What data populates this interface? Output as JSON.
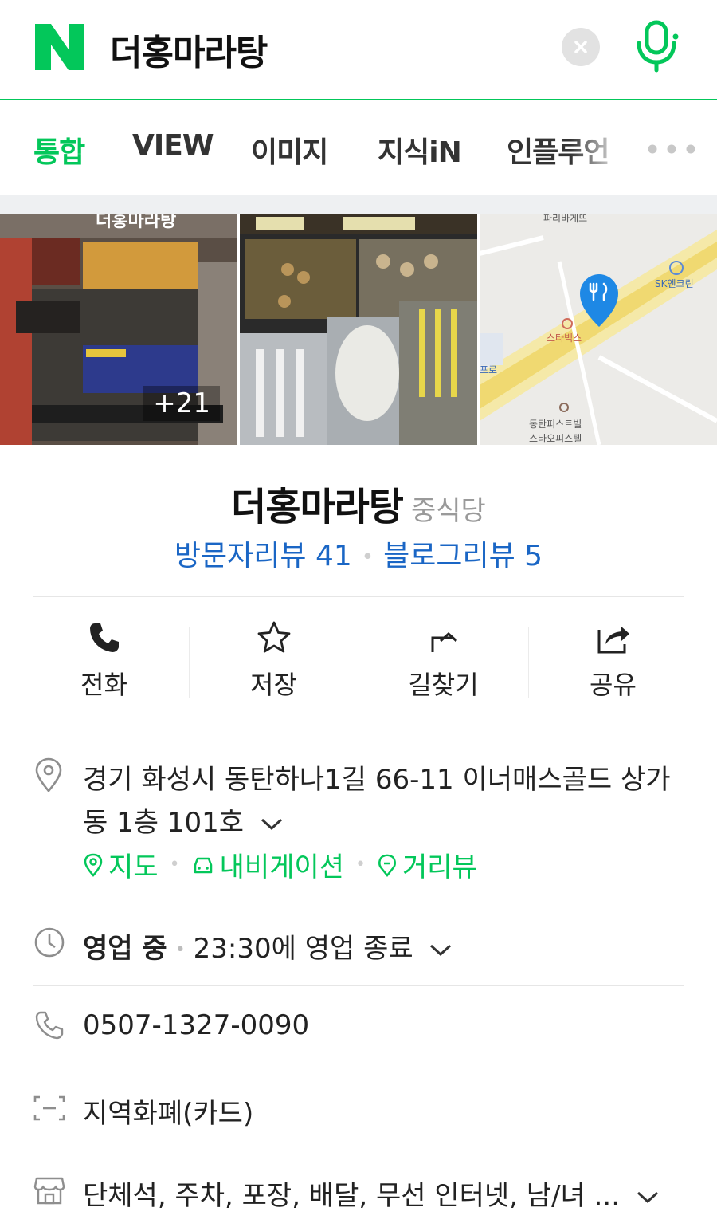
{
  "search": {
    "logo": "N",
    "query": "더홍마라탕",
    "brand_color": "#03c75a"
  },
  "tabs": [
    {
      "label": "통합",
      "active": true
    },
    {
      "label": "VIEW",
      "active": false
    },
    {
      "label": "이미지",
      "active": false
    },
    {
      "label": "지식iN",
      "active": false
    },
    {
      "label": "인플루언",
      "active": false
    }
  ],
  "photos": {
    "count_label": "+21",
    "storefront_text": "더홍마라탕",
    "map_labels": {
      "top": "파리바게뜨",
      "right": "SK엔크린",
      "cafe": "스타벅스",
      "left": "프로",
      "bottom1": "동탄퍼스트빌",
      "bottom2": "스타오피스텔"
    }
  },
  "place": {
    "name": "더홍마라탕",
    "category": "중식당",
    "visitor_reviews": "방문자리뷰 41",
    "blog_reviews": "블로그리뷰 5",
    "link_color": "#1a66c5"
  },
  "actions": {
    "call": "전화",
    "save": "저장",
    "directions": "길찾기",
    "share": "공유"
  },
  "info": {
    "address_line1": "경기 화성시 동탄하나1길 66-11 이너매스골드 상가",
    "address_line2": "동 1층 101호",
    "map_link": "지도",
    "navigation_link": "내비게이션",
    "street_view_link": "거리뷰",
    "hours_status": "영업 중",
    "hours_detail": "23:30에 영업 종료",
    "phone": "0507-1327-0090",
    "payment": "지역화폐(카드)",
    "amenities": "단체석, 주차, 포장, 배달, 무선 인터넷, 남/녀 ..."
  }
}
